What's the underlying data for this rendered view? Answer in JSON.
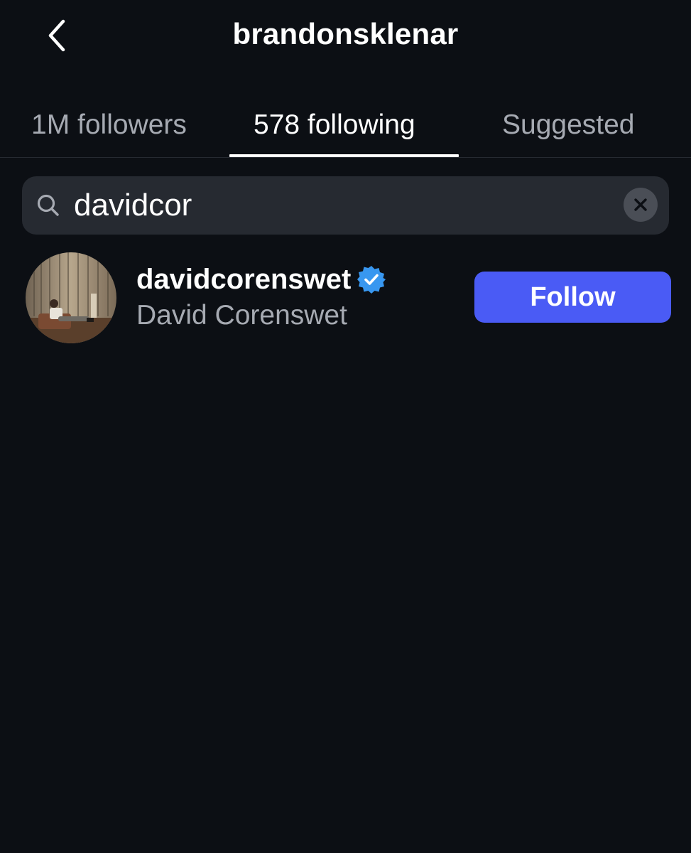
{
  "header": {
    "title": "brandonsklenar",
    "back_icon": "chevron-left-icon"
  },
  "tabs": [
    {
      "label": "1M followers",
      "active": false
    },
    {
      "label": "578 following",
      "active": true
    },
    {
      "label": "Suggested",
      "active": false
    }
  ],
  "search": {
    "value": "davidcor",
    "search_icon": "search-icon",
    "clear_icon": "close-icon"
  },
  "results": [
    {
      "username": "davidcorenswet",
      "full_name": "David Corenswet",
      "verified": true,
      "follow_label": "Follow"
    }
  ],
  "colors": {
    "background": "#0c0f14",
    "search_field": "#262a31",
    "muted_text": "#a6aab2",
    "follow_button": "#4a5bf5",
    "verified_badge": "#3897f0"
  }
}
